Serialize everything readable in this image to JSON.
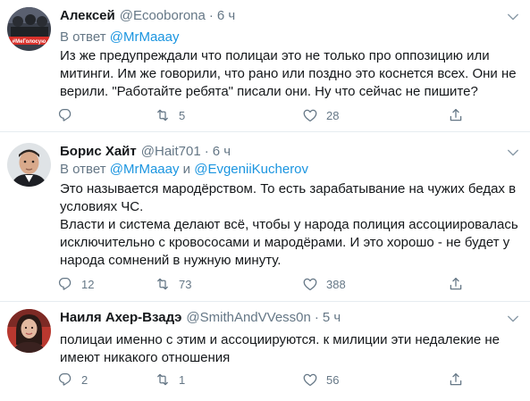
{
  "tweets": [
    {
      "name": "Алексей",
      "handle": "@Ecooborona",
      "dot": "·",
      "time": "6 ч",
      "avatar_badge": "#МеГолосую",
      "reply_prefix": "В ответ",
      "reply_to": [
        "@MrMaaay"
      ],
      "reply_conj": "",
      "text": [
        "Из же предупреждали что полицаи это не только про оппозицию или митинги. Им же говорили, что рано или поздно это коснется всех.  Они не верили. \"Работайте ребята\" писали они. Ну что сейчас не пишите?"
      ],
      "replies": "",
      "retweets": "5",
      "likes": "28"
    },
    {
      "name": "Борис Хайт",
      "handle": "@Hait701",
      "dot": "·",
      "time": "6 ч",
      "reply_prefix": "В ответ",
      "reply_to": [
        "@MrMaaay",
        "@EvgeniiKucherov"
      ],
      "reply_conj": "и",
      "text": [
        "Это называется мародёрством. То есть зарабатывание на чужих бедах в условиях ЧС.",
        "Власти и система делают всё, чтобы у народа полиция ассоциировалась исключительно с кровососами и мародёрами. И это хорошо - не будет у народа сомнений в нужную минуту."
      ],
      "replies": "12",
      "retweets": "73",
      "likes": "388"
    },
    {
      "name": "Наиля Ахер-Взадэ",
      "handle": "@SmithAndVVess0n",
      "dot": "·",
      "time": "5 ч",
      "text": [
        "полицаи именно с этим и ассоциируются. к милиции эти недалекие не имеют никакого отношения"
      ],
      "replies": "2",
      "retweets": "1",
      "likes": "56"
    }
  ],
  "icons": {
    "reply": "reply-icon",
    "retweet": "retweet-icon",
    "like": "heart-icon",
    "share": "share-icon",
    "more": "chevron-down-icon"
  },
  "colors": {
    "link": "#1b95e0",
    "secondary": "#657786",
    "text": "#14171a",
    "divider": "#e6ecf0"
  }
}
